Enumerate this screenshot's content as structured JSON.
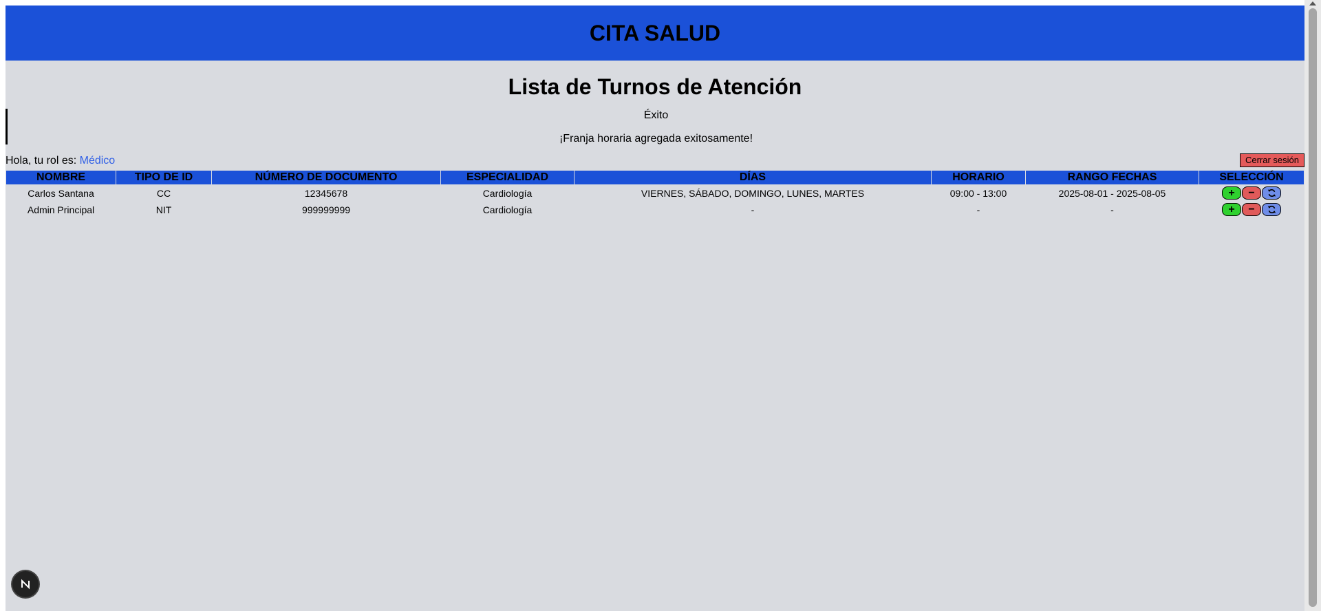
{
  "header": {
    "app_title": "CITA SALUD"
  },
  "page": {
    "title": "Lista de Turnos de Atención"
  },
  "alert": {
    "title": "Éxito",
    "message": "¡Franja horaria agregada exitosamente!"
  },
  "user": {
    "role_label": "Hola, tu rol es: ",
    "role_value": "Médico",
    "logout_label": "Cerrar sesión"
  },
  "table": {
    "columns": [
      "NOMBRE",
      "TIPO DE ID",
      "NÚMERO DE DOCUMENTO",
      "ESPECIALIDAD",
      "DÍAS",
      "HORARIO",
      "RANGO FECHAS",
      "SELECCIÓN"
    ],
    "rows": [
      {
        "nombre": "Carlos Santana",
        "tipo_id": "CC",
        "documento": "12345678",
        "especialidad": "Cardiología",
        "dias": "VIERNES, SÁBADO, DOMINGO, LUNES, MARTES",
        "horario": "09:00 - 13:00",
        "rango": "2025-08-01 - 2025-08-05"
      },
      {
        "nombre": "Admin Principal",
        "tipo_id": "NIT",
        "documento": "999999999",
        "especialidad": "Cardiología",
        "dias": "-",
        "horario": "-",
        "rango": "-"
      }
    ],
    "action_icons": {
      "add": "+",
      "remove": "−"
    }
  },
  "colors": {
    "header_bg": "#1b51d8",
    "page_bg": "#d9dbe0",
    "logout_bg": "#e55a5a",
    "add_btn": "#2fd12f",
    "remove_btn": "#e05a5a",
    "refresh_btn": "#6f8de8",
    "role_link": "#2f5fe6"
  },
  "badge": {
    "letter": "N"
  }
}
